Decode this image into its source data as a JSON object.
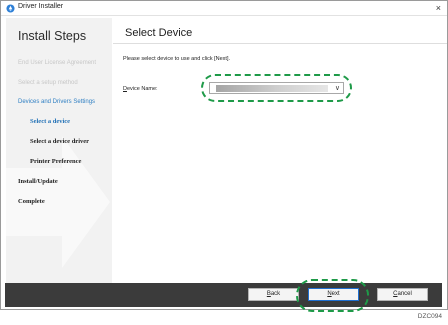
{
  "window": {
    "title": "Driver Installer",
    "close_glyph": "×"
  },
  "sidebar": {
    "heading": "Install Steps",
    "steps": [
      {
        "label": "End User License Agreement",
        "state": "faded"
      },
      {
        "label": "Select a setup method",
        "state": "faded"
      },
      {
        "label": "Devices and Drivers Settings",
        "state": "section"
      },
      {
        "label": "Select a device",
        "state": "current"
      },
      {
        "label": "Select a device driver",
        "state": "upcoming"
      },
      {
        "label": "Printer Preference",
        "state": "upcoming"
      },
      {
        "label": "Install/Update",
        "state": "upcoming"
      },
      {
        "label": "Complete",
        "state": "upcoming"
      }
    ]
  },
  "main": {
    "title": "Select Device",
    "instruction": "Please select device to use and click [Next].",
    "device_name": {
      "label_mnemonic": "D",
      "label_rest": "evice Name:",
      "value": "",
      "arrow_glyph": "∨"
    }
  },
  "footer": {
    "back": {
      "mnemonic": "B",
      "rest": "ack"
    },
    "next": {
      "mnemonic": "N",
      "rest": "ext"
    },
    "cancel": {
      "mnemonic": "C",
      "rest": "ancel"
    }
  },
  "figure_code": "DZC094",
  "colors": {
    "accent": "#1f6fb5",
    "section": "#2f7fc3",
    "callout": "#1e9a48",
    "footer_bg": "#3b3b3b",
    "sidebar_bg": "#f2f2f2"
  },
  "icons": {
    "app": "driver-installer-icon",
    "close": "close-icon",
    "dropdown": "chevron-down-icon"
  }
}
